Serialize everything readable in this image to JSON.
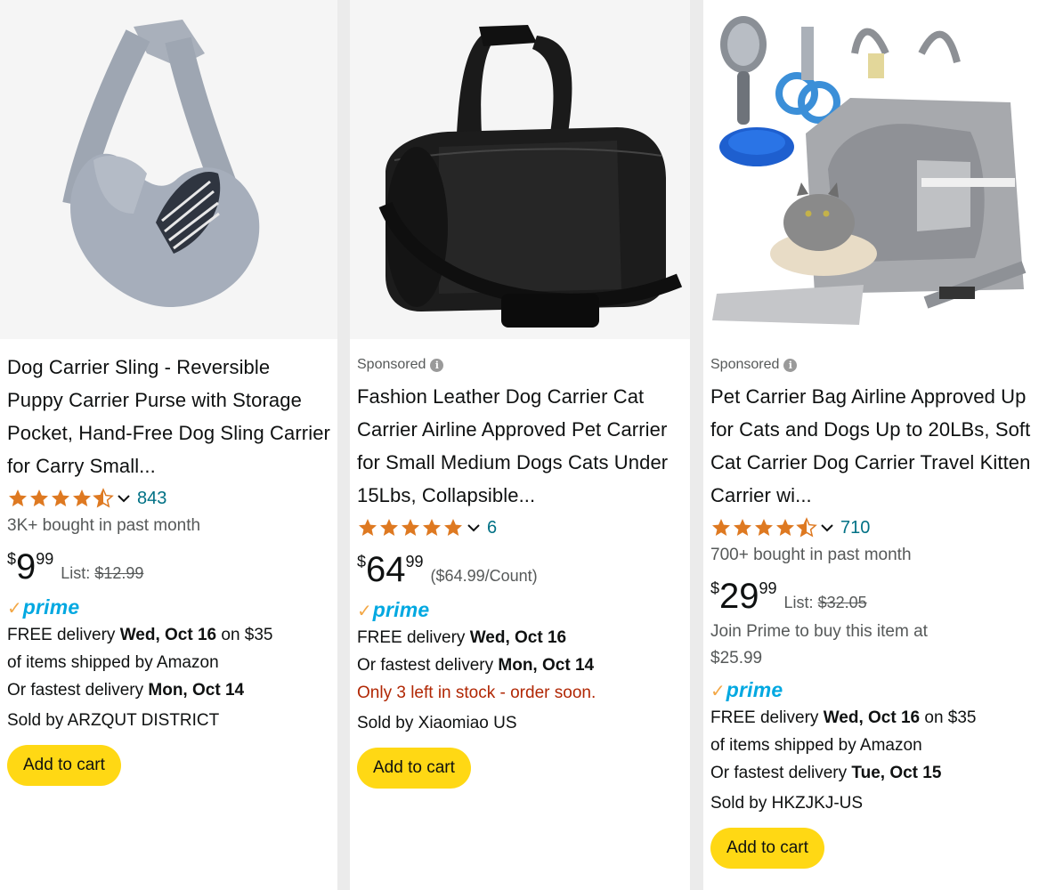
{
  "products": [
    {
      "title": "Dog Carrier Sling - Reversible Puppy Carrier Purse with Storage Pocket, Hand-Free Dog Sling Carrier for Carry Small...",
      "rating": 4.5,
      "review_count": "843",
      "bought": "3K+ bought in past month",
      "price_currency": "$",
      "price_whole": "9",
      "price_fraction": "99",
      "list_label": "List:",
      "list_price": "$12.99",
      "prime": "prime",
      "delivery_prefix": "FREE delivery ",
      "delivery_date": "Wed, Oct 16",
      "delivery_suffix": " on $35",
      "delivery_line2": "of items shipped by Amazon",
      "fastest_prefix": "Or fastest delivery ",
      "fastest_date": "Mon, Oct 14",
      "sold_by": "Sold by ARZQUT DISTRICT",
      "add_to_cart": "Add to cart"
    },
    {
      "sponsored": "Sponsored",
      "title": "Fashion Leather Dog Carrier Cat Carrier Airline Approved Pet Carrier for Small Medium Dogs Cats Under 15Lbs, Collapsible...",
      "rating": 5,
      "review_count": "6",
      "price_currency": "$",
      "price_whole": "64",
      "price_fraction": "99",
      "unit_price": "($64.99/Count)",
      "prime": "prime",
      "delivery_prefix": "FREE delivery ",
      "delivery_date": "Wed, Oct 16",
      "fastest_prefix": "Or fastest delivery ",
      "fastest_date": "Mon, Oct 14",
      "stock": "Only 3 left in stock - order soon.",
      "sold_by": "Sold by Xiaomiao US",
      "add_to_cart": "Add to cart"
    },
    {
      "sponsored": "Sponsored",
      "title": "Pet Carrier Bag Airline Approved Up for Cats and Dogs Up to 20LBs, Soft Cat Carrier Dog Carrier Travel Kitten Carrier wi...",
      "rating": 4.5,
      "review_count": "710",
      "bought": "700+ bought in past month",
      "price_currency": "$",
      "price_whole": "29",
      "price_fraction": "99",
      "list_label": "List:",
      "list_price": "$32.05",
      "join_prime": "Join Prime to buy this item at $25.99",
      "prime": "prime",
      "delivery_prefix": "FREE delivery ",
      "delivery_date": "Wed, Oct 16",
      "delivery_suffix": " on $35",
      "delivery_line2": "of items shipped by Amazon",
      "fastest_prefix": "Or fastest delivery ",
      "fastest_date": "Tue, Oct 15",
      "sold_by": "Sold by HKZJKJ-US",
      "add_to_cart": "Add to cart"
    }
  ],
  "colors": {
    "star": "#de7921",
    "link": "#007185",
    "prime_blue": "#00a8e1",
    "prime_check": "#f3a847",
    "cart_button": "#ffd814",
    "stock_warning": "#b12704"
  }
}
